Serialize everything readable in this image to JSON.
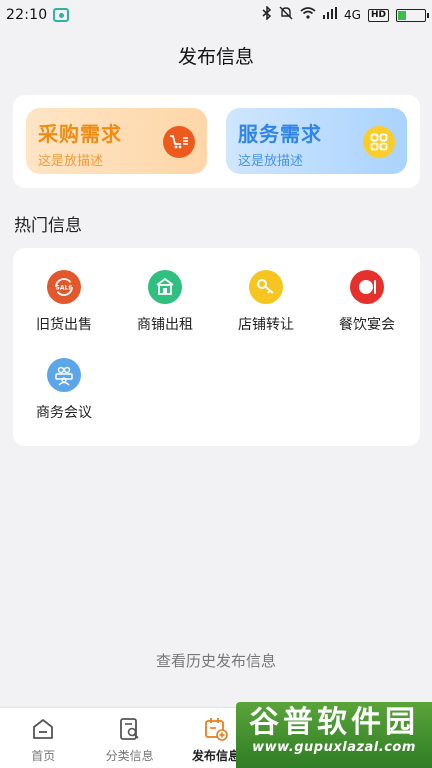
{
  "status_bar": {
    "time": "22:10",
    "network": "4G",
    "hd": "HD",
    "battery_level": 0.3
  },
  "header": {
    "title": "发布信息"
  },
  "demands": [
    {
      "title": "采购需求",
      "desc": "这是放描述",
      "icon": "shopping-cart-list-icon",
      "color": "#f08c14"
    },
    {
      "title": "服务需求",
      "desc": "这是放描述",
      "icon": "grid-apps-icon",
      "color": "#2f86e8"
    }
  ],
  "hot_section": {
    "title": "热门信息",
    "items": [
      {
        "label": "旧货出售",
        "icon": "sale-recycle-icon",
        "color": "#e2572b"
      },
      {
        "label": "商铺出租",
        "icon": "shop-icon",
        "color": "#2fbf7f"
      },
      {
        "label": "店铺转让",
        "icon": "key-icon",
        "color": "#f7c51f"
      },
      {
        "label": "餐饮宴会",
        "icon": "plate-icon",
        "color": "#e5302b"
      },
      {
        "label": "商务会议",
        "icon": "meeting-icon",
        "color": "#5aa6e8"
      }
    ]
  },
  "history_link": "查看历史发布信息",
  "tab_bar": {
    "tabs": [
      {
        "label": "首页",
        "icon": "home-icon"
      },
      {
        "label": "分类信息",
        "icon": "category-search-icon"
      },
      {
        "label": "发布信息",
        "icon": "publish-calendar-icon",
        "active": true
      }
    ]
  },
  "watermark": {
    "big": "谷普软件园",
    "small": "www.gupuxlazal.com"
  }
}
